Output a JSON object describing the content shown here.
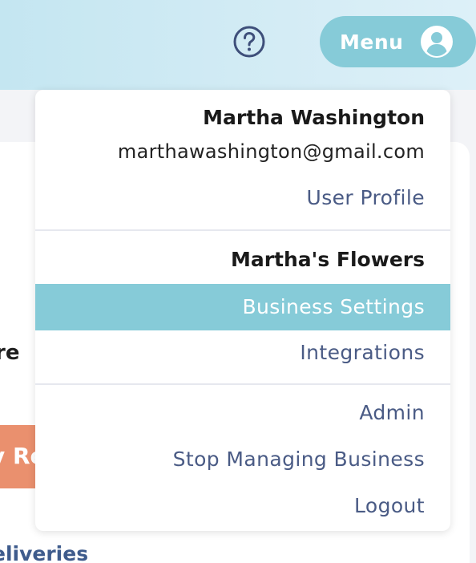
{
  "header": {
    "help_icon": "question-circle-icon",
    "menu_button": {
      "label": "Menu",
      "icon": "user-avatar-icon"
    }
  },
  "background": {
    "partial_heading": "re",
    "partial_button": "y Re",
    "partial_link": "eliveries"
  },
  "dropdown": {
    "user": {
      "name": "Martha Washington",
      "email": "marthawashington@gmail.com",
      "profile_link": "User Profile"
    },
    "business": {
      "name": "Martha's Flowers",
      "settings_link": "Business Settings",
      "integrations_link": "Integrations"
    },
    "actions": {
      "admin": "Admin",
      "stop_managing": "Stop Managing Business",
      "logout": "Logout"
    }
  },
  "colors": {
    "accent": "#86cbd8",
    "link": "#4a5b85",
    "orange": "#ea906e"
  }
}
